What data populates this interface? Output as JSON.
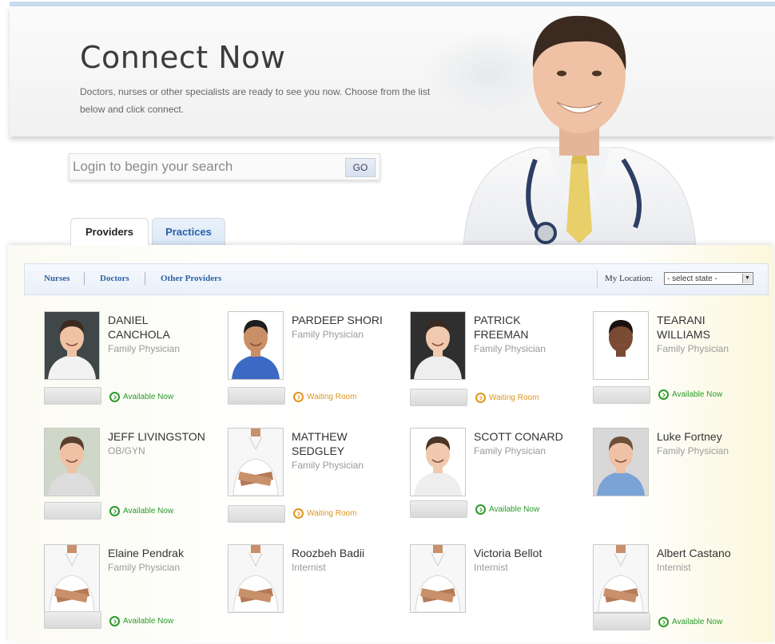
{
  "header": {
    "title": "Connect Now",
    "subtitle": "Doctors, nurses or other specialists are ready to see you now. Choose from the list below and click connect."
  },
  "search": {
    "placeholder": "Login to begin your search",
    "go_label": "GO"
  },
  "tabs": [
    {
      "label": "Providers",
      "active": true
    },
    {
      "label": "Practices",
      "active": false
    }
  ],
  "filters": {
    "links": [
      "Nurses",
      "Doctors",
      "Other Providers"
    ],
    "location_label": "My Location:",
    "state_value": "- select state -"
  },
  "colors": {
    "available": "#2a9a2a",
    "waiting": "#e0951c",
    "link": "#2f62a6"
  },
  "providers": [
    {
      "name": "DANIEL CANCHOLA",
      "specialty": "Family Physician",
      "status": "Available Now",
      "photo": "photo"
    },
    {
      "name": "PARDEEP SHORI",
      "specialty": "Family Physician",
      "status": "Waiting Room",
      "photo": "photo"
    },
    {
      "name": "PATRICK FREEMAN",
      "specialty": "Family Physician",
      "status": "Waiting Room",
      "photo": "photo"
    },
    {
      "name": "TEARANI WILLIAMS",
      "specialty": "Family Physician",
      "status": "Available Now",
      "photo": "photo"
    },
    {
      "name": "JEFF LIVINGSTON",
      "specialty": "OB/GYN",
      "status": "Available Now",
      "photo": "photo"
    },
    {
      "name": "MATTHEW SEDGLEY",
      "specialty": "Family Physician",
      "status": "Waiting Room",
      "photo": "placeholder"
    },
    {
      "name": "SCOTT CONARD",
      "specialty": "Family Physician",
      "status": "Available Now",
      "photo": "photo"
    },
    {
      "name": "Luke Fortney",
      "specialty": "Family Physician",
      "status": "",
      "photo": "photo"
    },
    {
      "name": "Elaine Pendrak",
      "specialty": "Family Physician",
      "status": "Available Now",
      "photo": "placeholder"
    },
    {
      "name": "Roozbeh Badii",
      "specialty": "Internist",
      "status": "",
      "photo": "placeholder"
    },
    {
      "name": "Victoria Bellot",
      "specialty": "Internist",
      "status": "",
      "photo": "placeholder"
    },
    {
      "name": "Albert Castano",
      "specialty": "Internist",
      "status": "Available Now",
      "photo": "placeholder"
    }
  ]
}
